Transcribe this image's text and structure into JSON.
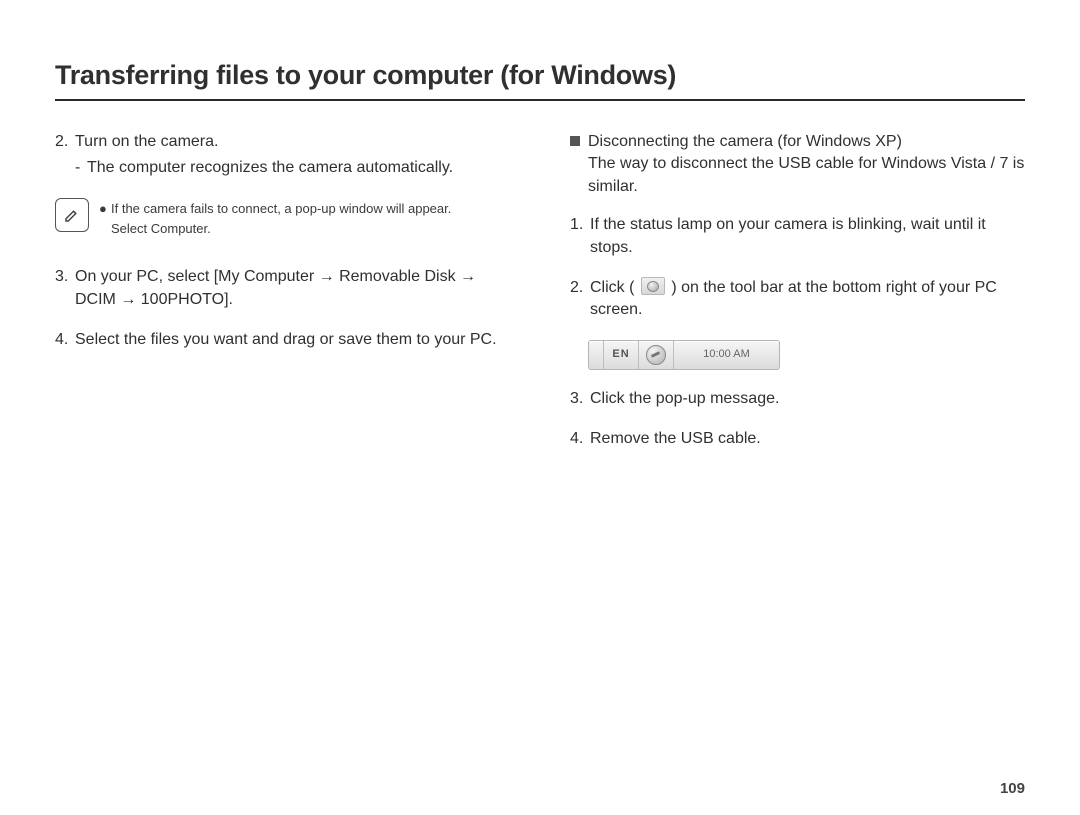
{
  "title": "Transferring files to your computer (for Windows)",
  "pageNumber": "109",
  "left": {
    "step2": {
      "num": "2.",
      "text": "Turn on the camera.",
      "sub": "The computer recognizes the camera automatically."
    },
    "note": {
      "line1": "If the camera fails to connect, a pop-up window will appear.",
      "line2": "Select Computer."
    },
    "step3": {
      "num": "3.",
      "text": "On your PC, select [My Computer → Removable Disk → DCIM → 100PHOTO]."
    },
    "step4": {
      "num": "4.",
      "text": "Select the files you want and drag or save them to your PC."
    }
  },
  "right": {
    "heading": "Disconnecting the camera (for Windows XP)",
    "subhead": "The way to disconnect the USB cable for Windows Vista / 7 is similar.",
    "step1": {
      "num": "1.",
      "text": "If the status lamp on your camera is blinking, wait until it stops."
    },
    "step2": {
      "num": "2.",
      "pre": "Click (",
      "post": ") on the tool bar at the bottom right of your PC screen."
    },
    "taskbar": {
      "lang": "EN",
      "time": "10:00 AM"
    },
    "step3": {
      "num": "3.",
      "text": "Click the pop-up message."
    },
    "step4": {
      "num": "4.",
      "text": "Remove the USB cable."
    }
  }
}
